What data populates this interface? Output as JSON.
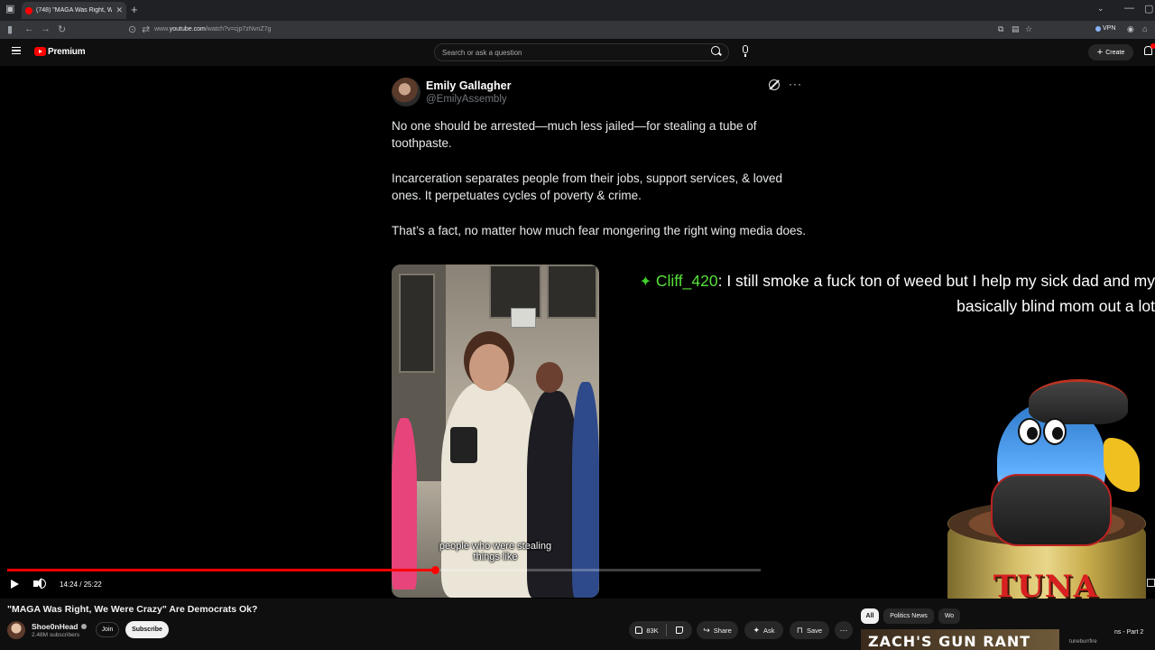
{
  "browser": {
    "tab_title": "(748) \"MAGA Was Right, We W",
    "url_prefix": "www.",
    "url_host": "youtube.com",
    "url_path": "/watch?v=cjp7zNvnZ7g",
    "vpn_label": "VPN"
  },
  "youtube": {
    "brand": "Premium",
    "search_placeholder": "Search or ask a question",
    "create_label": "Create"
  },
  "tweet": {
    "name": "Emily Gallagher",
    "handle": "@EmilyAssembly",
    "para1": "No one should be arrested—much less jailed—for stealing a tube of toothpaste.",
    "para2": "Incarceration separates people from their jobs, support services, & loved ones. It perpetuates cycles of poverty & crime.",
    "para3": "That’s a fact, no matter how much fear mongering the right wing media does.",
    "caption_line1": "people who were stealing",
    "caption_line2": "things like"
  },
  "chat": {
    "badge": "✦",
    "user": "Cliff_420",
    "message": ": I still smoke a fuck ton of weed but I help my sick dad and my basically blind mom out a lot"
  },
  "overlay": {
    "can_label": "TUNA"
  },
  "player": {
    "current_time": "14:24",
    "duration": "25:22",
    "progress_fraction": 0.5677,
    "buffered_fraction": 0.995
  },
  "video": {
    "title": "\"MAGA Was Right, We Were Crazy\" Are Democrats Ok?",
    "channel": "Shoe0nHead",
    "subscribers": "2.48M subscribers",
    "join_label": "Join",
    "subscribe_label": "Subscribe",
    "likes": "83K",
    "share_label": "Share",
    "ask_label": "Ask",
    "save_label": "Save"
  },
  "sidebar": {
    "chips": [
      "All",
      "Politics News",
      "Wo"
    ],
    "next_thumb_text": "ZACH'S GUN RANT",
    "next_title_fragment": "ns - Part 2",
    "next_channel_fragment": "tuneburrfire"
  },
  "colors": {
    "brand_red": "#ff0000",
    "chat_user_green": "#57e03a",
    "tweet_text": "#e7e9ea",
    "handle_gray": "#71767b"
  }
}
